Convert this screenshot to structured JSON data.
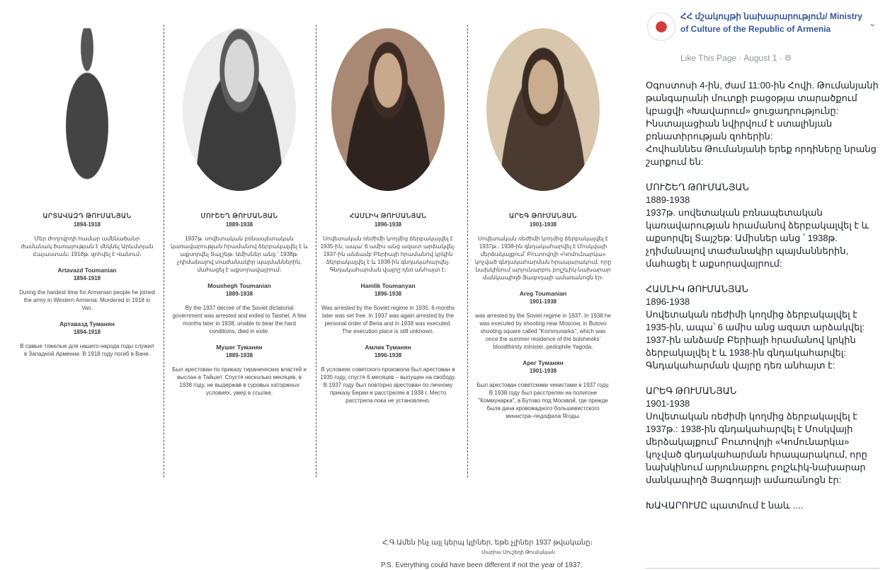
{
  "people": [
    {
      "name_hy": "ԱՐՏԱՎԱԶԴ ԹՈՒՄԱՆՅԱՆ",
      "years": "1894-1918",
      "text_hy": "Մեր ժողովրդի համար ամենածանր ժամանակ ծառայության է մեկնել Արևմտյան Հայաստան։ 1918թ. զոհվել է Վանում։",
      "name_en": "Artavazd Toumanian",
      "years_en": "1894-1918",
      "text_en": "During the hardest time for Armenian people he joined the army in Western Armenia. Murdered in 1918 in Van.",
      "name_ru": "Артавазд Туманян",
      "years_ru": "1894-1918",
      "text_ru": "В самые тяжелые для нашего народа годы служил в Западной Армении. В 1918 году погиб в Ване."
    },
    {
      "name_hy": "ՄՈՒՇԵՂ ԹՈՒՄԱՆՅԱՆ",
      "years": "1889-1938",
      "text_hy": "1937թ. սովետական բռնապետական կառավարության հրամանով ձերբակալվել է և աքսորվել Տայշեթ։ Ամիսներ անց ՝ 1938թ. չդիմանալով տաժանակիր պայմաններին, մահացել է աքսորավայրում։",
      "name_en": "Moushegh Toumanian",
      "years_en": "1889-1938",
      "text_en": "By the 1937 decree of the Soviet dictatorial government was arrested and exiled to Taishet. A few months later in 1938, unable to bear the hard conditions, died in exile.",
      "name_ru": "Мушег Туманян",
      "years_ru": "1889-1938",
      "text_ru": "Был арестован по приказу тиранических властей и выслан в Тайшет. Спустя несколько месяцев, в 1938 году, не выдержав в суровых каторжных условиях, умер в ссылке."
    },
    {
      "name_hy": "ՀԱՄԼԻԿ ԹՈՒՄԱՆՅԱՆ",
      "years": "1896-1938",
      "text_hy": "Սովետական ռեժիմի կողմից ձերբակալվել է 1935-ին, ապա՝ 6 ամիս անց ազատ արձակվել։ 1937-ին անձամբ Բերիայի հրամանով կրկին ձերբակալվել է և 1938-ին գնդակահարվել։ Գնդակահարման վայրը դեռ անհայտ է։",
      "name_en": "Hamlik Toumanyan",
      "years_en": "1896-1938",
      "text_en": "Was arrested by the Soviet regime in 1935. 6 months later was set free. In 1937 was again arrested by the personal order of Beria and in 1938 was executed. The execution place is still unknown.",
      "name_ru": "Амлик Туманян",
      "years_ru": "1896-1938",
      "text_ru": "В условиях советского произвола был арестован в 1935 году, спустя 6 месяцев – выпущен на свободу. В 1937 году был повторно арестован по личному приказу Берии и расстрелян в 1938 г. Место расстрела пока не установлено."
    },
    {
      "name_hy": "ԱՐԵԳ ԹՈՒՄԱՆՅԱՆ",
      "years": "1901-1938",
      "text_hy": "Սովետական ռեժիմի կողմից ձերբակալվել է 1937թ.։ 1938-ին գնդակահարվել է Մոսկվայի մերձակայքում՝ Բուտովոյի «Կոմունարկա» կոչված գնդակահարման հրապարակում, որը նախկինում արյունարբու բոլշևիկ-նախարար մանկապիղծ Յագոդայի ամառանոցն էր։",
      "name_en": "Areg Toumanian",
      "years_en": "1901-1938",
      "text_en": "was arrested by the Soviet regime in 1937. In 1938 he was executed by shooting near Moscow, in Butovo shooting square called \"Kommunarka\", which was once the summer residence of the bolsheviks' bloodthirsty minister, pedophile Yagoda.",
      "name_ru": "Арег Туманян",
      "years_ru": "1901-1938",
      "text_ru": "Был арестован советскими чекистами в 1937 году. В 1938 году был расстрелян на полигоне \"Коммунарка\", в Бутово под Москвой, где прежде была дача кровожадного большевистского министра–педофила Ягоды."
    }
  ],
  "signature": {
    "hy": "Հ.Գ.Ամեն ինչ այլ կերպ կլիներ, եթե չլիներ 1937 թվականը։",
    "author": "Մարիա Մուշեղի Թումանյան",
    "en": "P.S. Everything could have been different if not the year of 1937."
  },
  "fb": {
    "page_name": "ՀՀ մշակույթի նախարարություն/ Ministry of Culture of the Republic of Armenia",
    "like": "Like This Page",
    "sep": "·",
    "date": "August 1",
    "sep2": "·",
    "globe": "globe-icon",
    "chevron": "chevron-down-icon",
    "post_text": "Օգոստոսի 4-ին, ժամ 11:00-ին Հովի. Թումանյանի թանգարանի մուտքի բացօթյա տարածքում կբացվի «Խավարում» ցուցադրությունը:\nԻնստալացիան նվիրվում է ստալինյան բռնատիրության զոհերին:\nՀովհաննես Թումանյանի երեք որդիները նրանց շարքում են:\n\nՄՈՒՇԵՂ ԹՈՒՄԱՆՅԱՆ\n1889-1938\n1937թ. սովետական բռնապետական կառավարության հրամանով ձերբակալվել է և աքսորվել Տայշեթ: Ամիսներ անց ՝ 1938թ. չդիմանալով տաժանակիր պայմաններին, մահացել է աքսորավայրում:\n\nՀԱՄԼԻԿ ԹՈՒՄԱՆՅԱՆ\n1896-1938\nՍովետական ռեժիմի կողմից ձերբակալվել է 1935-ին, ապա՝ 6 ամիս անց ազատ արձակվել: 1937-ին անձամբ Բերիայի հրամանով կրկին ձերբակալվել է և 1938-ին գնդակահարվել: Գնդակահարման վայրը դեռ անհայտ է:\n\nԱՐԵԳ ԹՈՒՄԱՆՅԱՆ\n1901-1938\nՍովետական ռեժիմի կողմից ձերբակալվել է 1937թ.: 1938-ին գնդակահարվել է Մոսկվայի մերձակայքում՝ Բուտովոյի «Կոմունարկա» կոչված գնդակահարման հրապարակում, որը նախկինում արյունարբու բոլշևիկ-նախարար մանկապիղծ Յագոդայի ամառանոցն էր:\n\nԽԱՎԱՐՈՒՄԸ պատմում է նաև ...."
  }
}
